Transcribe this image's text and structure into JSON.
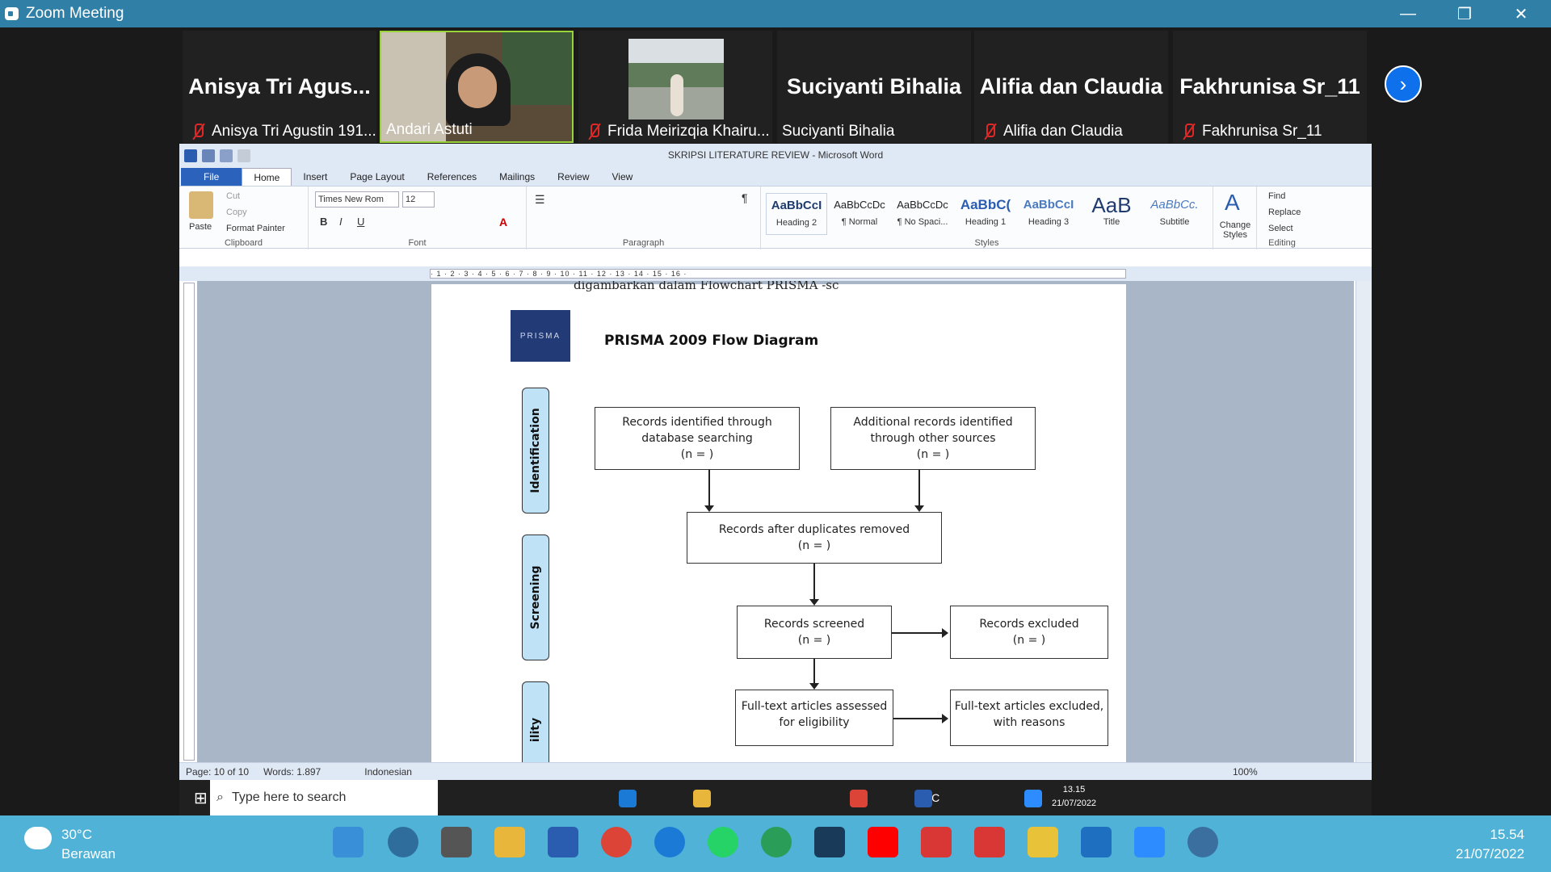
{
  "zoom": {
    "title": "Zoom Meeting",
    "win_min": "—",
    "win_max": "❐",
    "win_close": "✕"
  },
  "participants": [
    {
      "big": "Anisya Tri Agus...",
      "name": "Anisya Tri Agustin 191...",
      "muted": true
    },
    {
      "big": "",
      "name": "Andari Astuti",
      "muted": false
    },
    {
      "big": "",
      "name": "Frida Meirizqia Khairu...",
      "muted": true
    },
    {
      "big": "Suciyanti Bihalia",
      "name": "Suciyanti Bihalia",
      "muted": false
    },
    {
      "big": "Alifia dan Claudia",
      "name": "Alifia dan Claudia",
      "muted": true
    },
    {
      "big": "Fakhrunisa Sr_11",
      "name": "Fakhrunisa Sr_11",
      "muted": true
    }
  ],
  "word": {
    "title": "SKRIPSI LITERATURE REVIEW  -  Microsoft Word",
    "tabs": [
      "File",
      "Home",
      "Insert",
      "Page Layout",
      "References",
      "Mailings",
      "Review",
      "View"
    ],
    "clipboard": {
      "paste": "Paste",
      "cut": "Cut",
      "copy": "Copy",
      "format_painter": "Format Painter",
      "label": "Clipboard"
    },
    "font": {
      "name": "Times New Rom",
      "size": "12",
      "label": "Font"
    },
    "paragraph_label": "Paragraph",
    "styles": [
      {
        "preview": "AaBbCcI",
        "name": "Heading 2"
      },
      {
        "preview": "AaBbCcDc",
        "name": "¶ Normal"
      },
      {
        "preview": "AaBbCcDc",
        "name": "¶ No Spaci..."
      },
      {
        "preview": "AaBbC(",
        "name": "Heading 1"
      },
      {
        "preview": "AaBbCcI",
        "name": "Heading 3"
      },
      {
        "preview": "AaB",
        "name": "Title"
      },
      {
        "preview": "AaBbCc.",
        "name": "Subtitle"
      }
    ],
    "styles_label": "Styles",
    "change_styles": "Change Styles",
    "editing": {
      "find": "Find",
      "replace": "Replace",
      "select": "Select",
      "label": "Editing"
    },
    "ruler_text": "· 1 · 2 · 3 · 4 · 5 · 6 · 7 · 8 · 9 · 10 · 11 · 12 · 13 · 14 · 15 · 16 ·",
    "doc_top_text": "digambarkan dalam Flowchart PRISMA -sc",
    "prisma_logo": "PRISMA",
    "diagram_title": "PRISMA 2009 Flow Diagram",
    "side_labels": [
      "Identification",
      "Screening",
      "ility"
    ],
    "boxes": {
      "db": [
        "Records identified through",
        "database searching",
        "(n =   )"
      ],
      "other": [
        "Additional records identified",
        "through other sources",
        "(n =   )"
      ],
      "dup": [
        "Records after duplicates removed",
        "(n =   )"
      ],
      "screened": [
        "Records screened",
        "(n =   )"
      ],
      "excluded": [
        "Records excluded",
        "(n =   )"
      ],
      "fulltext": [
        "Full-text articles assessed",
        "for eligibility"
      ],
      "ft_excluded": [
        "Full-text articles excluded,",
        "with reasons"
      ]
    },
    "status": {
      "page": "Page: 10 of 10",
      "words": "Words: 1.897",
      "lang": "Indonesian",
      "zoom": "100%"
    }
  },
  "win_taskbar": {
    "search": "Type here to search",
    "weather": "30°C",
    "time": "13.15",
    "date": "21/07/2022"
  },
  "host_taskbar": {
    "temp": "30°C",
    "cond": "Berawan",
    "time": "15.54",
    "date": "21/07/2022"
  }
}
